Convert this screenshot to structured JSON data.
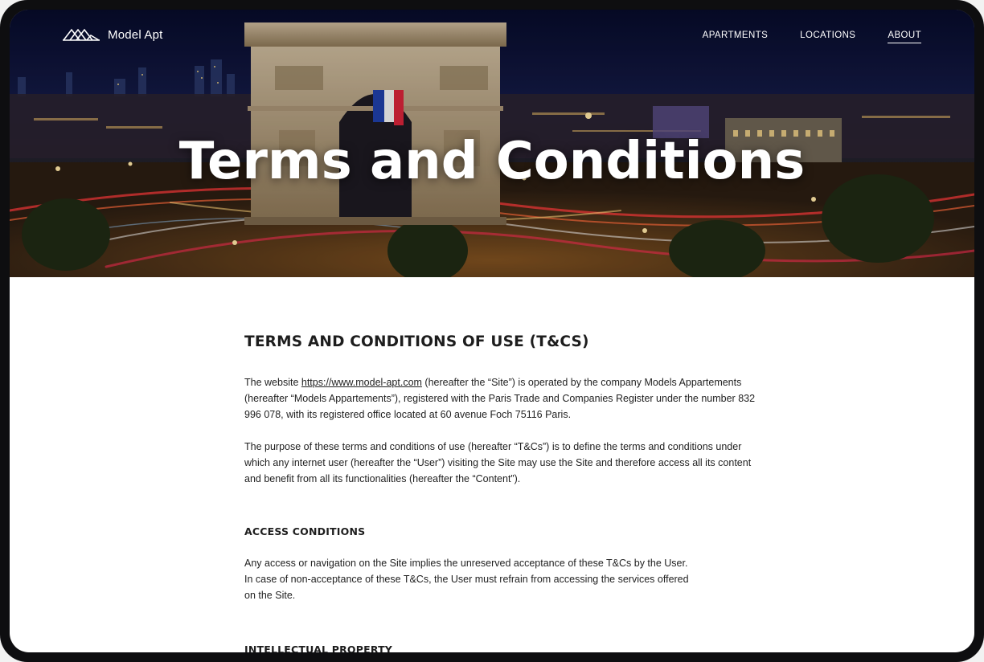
{
  "brand": {
    "name": "Model Apt",
    "logo_icon": "mountain-logo-icon"
  },
  "nav": {
    "items": [
      {
        "label": "APARTMENTS",
        "active": false
      },
      {
        "label": "LOCATIONS",
        "active": false
      },
      {
        "label": "ABOUT",
        "active": true
      }
    ]
  },
  "hero": {
    "title": "Terms and Conditions",
    "image": "Arc de Triomphe at night with light trails"
  },
  "document": {
    "title": "TERMS AND CONDITIONS OF USE (T&CS)",
    "intro": {
      "before_link": "The website ",
      "link_text": "https://www.model-apt.com",
      "after_link": " (hereafter the “Site”) is operated by the company Models Appartements (hereafter “Models Appartements”), registered with the Paris Trade and Companies Register under the number 832 996 078, with its registered office located at 60 avenue Foch 75116 Paris."
    },
    "purpose": "The purpose of these terms and conditions of use (hereafter “T&Cs”) is to define the terms and conditions under which any internet user (hereafter the “User”) visiting the Site may use the Site and therefore access all its content and benefit from all its functionalities (hereafter the “Content”).",
    "sections": [
      {
        "title": "ACCESS CONDITIONS",
        "lines": [
          "Any access or navigation on the Site implies the unreserved acceptance of these T&Cs by the User.",
          "In case of non-acceptance of these T&Cs, the User must refrain from accessing the services offered",
          "on  the Site."
        ]
      },
      {
        "title": "INTELLECTUAL PROPERTY"
      }
    ]
  },
  "colors": {
    "device_frame": "#0e0e10",
    "page_bg": "#ffffff",
    "text": "#222222",
    "nav_text": "#ffffff"
  }
}
